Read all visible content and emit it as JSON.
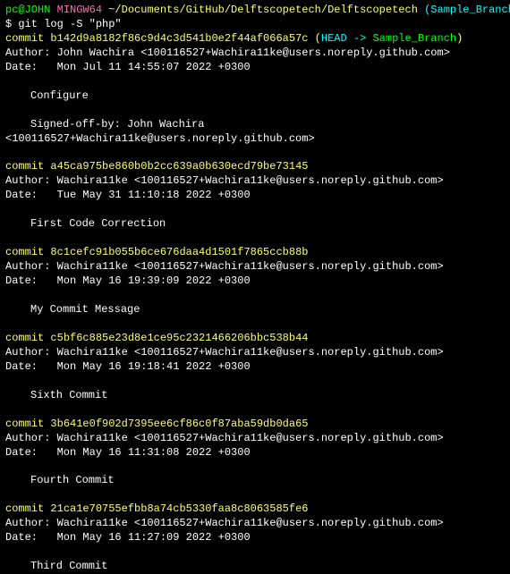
{
  "prompt": {
    "user_host": "pc@JOHN",
    "mingw": " MINGW64",
    "path": " ~/Documents/GitHub/Delftscopetech/Delftscopetech",
    "branch": " (Sample_Branch)"
  },
  "command_line": "$ git log -S \"php\"",
  "commits": [
    {
      "label": "commit ",
      "hash": "b142d9a8182f86c9d4c3d541b0e2f44af066a57c",
      "head_open": " (",
      "head_text": "HEAD ->",
      "head_branch": " Sample_Branch",
      "head_close": ")",
      "author": "Author: John Wachira <100116527+Wachira11ke@users.noreply.github.com>",
      "date": "Date:   Mon Jul 11 14:55:07 2022 +0300",
      "message": "Configure",
      "signoff": "Signed-off-by: John Wachira <100116527+Wachira11ke@users.noreply.github.com>"
    },
    {
      "label": "commit ",
      "hash": "a45ca975be860b0b2cc639a0b630ecd79be73145",
      "author": "Author: Wachira11ke <100116527+Wachira11ke@users.noreply.github.com>",
      "date": "Date:   Tue May 31 11:10:18 2022 +0300",
      "message": "First Code Correction"
    },
    {
      "label": "commit ",
      "hash": "8c1cefc91b055b6ce676daa4d1501f7865ccb88b",
      "author": "Author: Wachira11ke <100116527+Wachira11ke@users.noreply.github.com>",
      "date": "Date:   Mon May 16 19:39:09 2022 +0300",
      "message": "My Commit Message"
    },
    {
      "label": "commit ",
      "hash": "c5bf6c885e23d8e1ce95c2321466206bbc538b44",
      "author": "Author: Wachira11ke <100116527+Wachira11ke@users.noreply.github.com>",
      "date": "Date:   Mon May 16 19:18:41 2022 +0300",
      "message": "Sixth Commit"
    },
    {
      "label": "commit ",
      "hash": "3b641e0f902d7395ee6cf86c0f87aba59db0da65",
      "author": "Author: Wachira11ke <100116527+Wachira11ke@users.noreply.github.com>",
      "date": "Date:   Mon May 16 11:31:08 2022 +0300",
      "message": "Fourth Commit"
    },
    {
      "label": "commit ",
      "hash": "21ca1e70755efbb8a74cb5330faa8c8063585fe6",
      "author": "Author: Wachira11ke <100116527+Wachira11ke@users.noreply.github.com>",
      "date": "Date:   Mon May 16 11:27:09 2022 +0300",
      "message": "Third Commit"
    }
  ]
}
